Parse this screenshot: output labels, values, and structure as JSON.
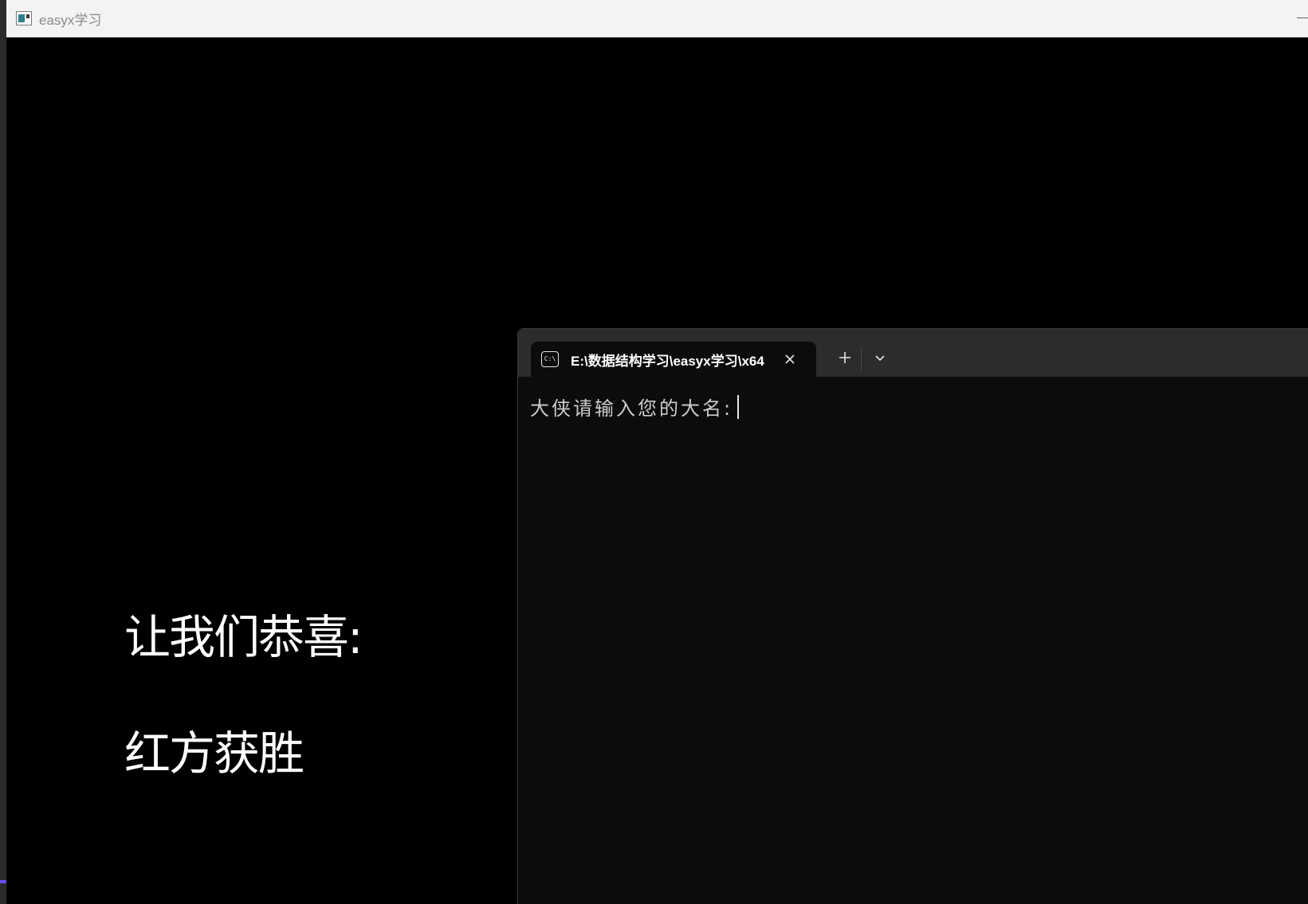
{
  "easyx_window": {
    "title": "easyx学习",
    "minimize_glyph": "—"
  },
  "canvas": {
    "line1": "让我们恭喜:",
    "line2": "红方获胜"
  },
  "terminal": {
    "tab_title": "E:\\数据结构学习\\easyx学习\\x64",
    "tab_icon_text": "C:\\",
    "close_icon": "close-icon",
    "new_tab_icon": "plus-icon",
    "dropdown_icon": "chevron-down-icon",
    "prompt": "大侠请输入您的大名:",
    "input_value": ""
  },
  "colors": {
    "canvas_bg": "#000000",
    "terminal_bg": "#0c0c0c",
    "tabbar_bg": "#2c2c2c",
    "text_white": "#ffffff",
    "prompt_text": "#cccccc",
    "titlebar_bg": "#f3f3f3"
  }
}
